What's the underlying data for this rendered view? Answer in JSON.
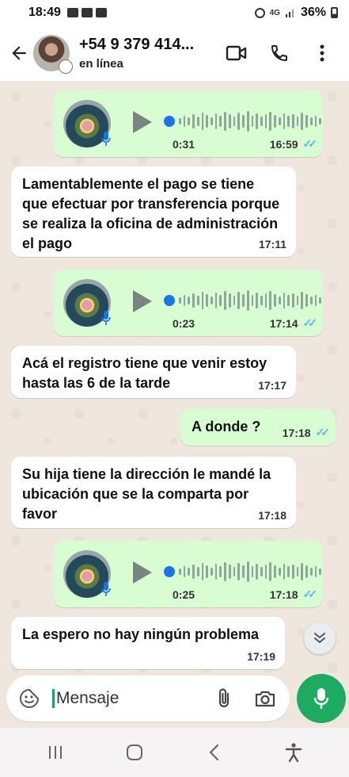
{
  "status_bar": {
    "time": "18:49",
    "network": "4G",
    "battery": "36%"
  },
  "header": {
    "contact_name": "+54 9 379 414...",
    "contact_status": "en línea"
  },
  "messages": [
    {
      "type": "voice",
      "direction": "out",
      "duration": "0:31",
      "time": "16:59",
      "read": true
    },
    {
      "type": "text",
      "direction": "in",
      "text": "Lamentablemente el pago se tiene que efectuar por transferencia porque se realiza la oficina de administración el pago",
      "time": "17:11"
    },
    {
      "type": "voice",
      "direction": "out",
      "duration": "0:23",
      "time": "17:14",
      "read": true
    },
    {
      "type": "text",
      "direction": "in",
      "text": "Acá el registro tiene que venir estoy hasta las 6 de la tarde",
      "time": "17:17"
    },
    {
      "type": "text",
      "direction": "out",
      "text": "A donde ?",
      "time": "17:18",
      "read": true
    },
    {
      "type": "text",
      "direction": "in",
      "text": "Su hija tiene la dirección le mandé la ubicación que se la comparta por favor",
      "time": "17:18"
    },
    {
      "type": "voice",
      "direction": "out",
      "duration": "0:25",
      "time": "17:18",
      "read": true
    },
    {
      "type": "text",
      "direction": "in",
      "text": "La espero no hay ningún problema",
      "time": "17:19"
    }
  ],
  "composer": {
    "placeholder": "Mensaje"
  },
  "colors": {
    "outgoing_bubble": "#d9fdd3",
    "incoming_bubble": "#ffffff",
    "chat_background": "#efe7de",
    "accent_green": "#1daa61",
    "read_ticks": "#53bdeb"
  }
}
